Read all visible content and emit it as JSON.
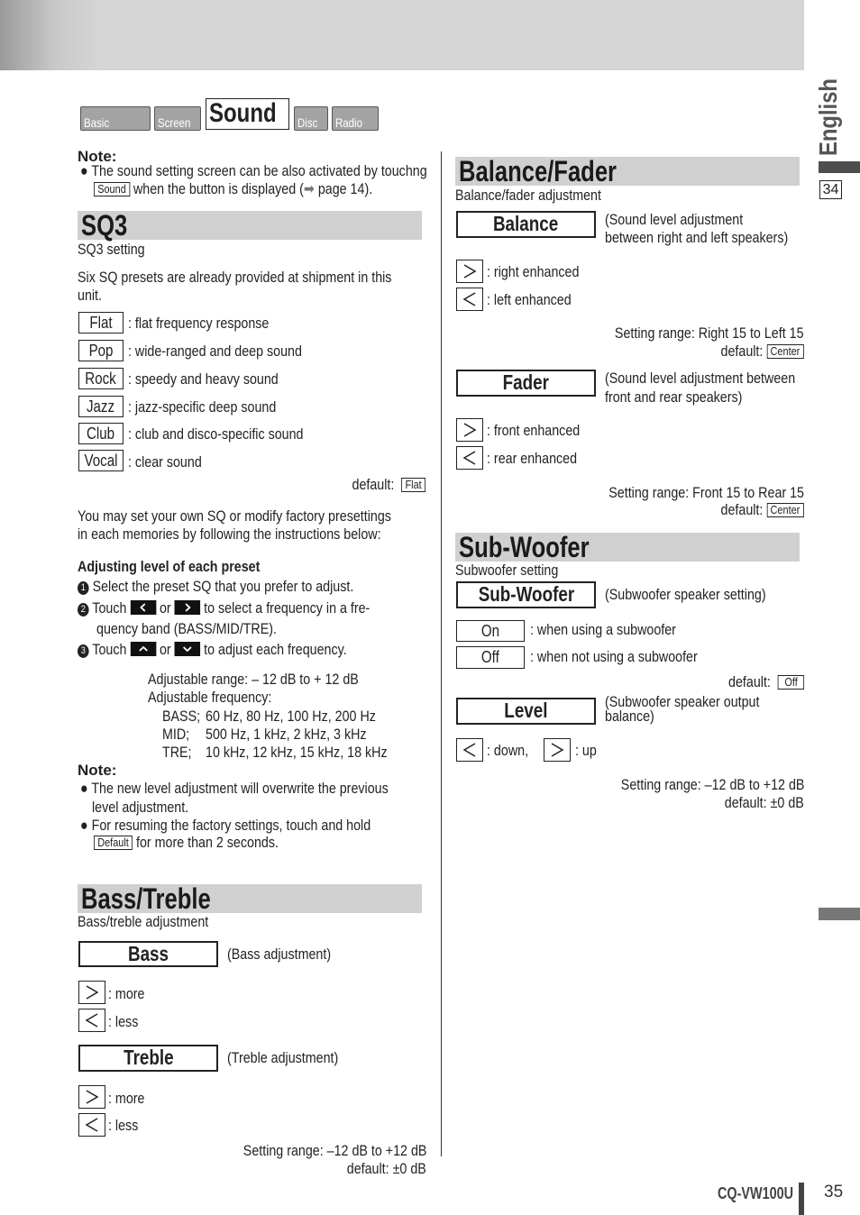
{
  "tabs": [
    "Basic Setting",
    "Screen",
    "Sound",
    "Disc",
    "Radio"
  ],
  "note1": {
    "title": "Note:",
    "line1": "The sound setting screen can be also activated by touchng",
    "button": "Sound",
    "line2": "when the button is displayed (",
    "arrow": "➡",
    "line2b": " page 14)."
  },
  "sq3": {
    "title": "SQ3",
    "subtitle": "SQ3 setting",
    "intro1": "Six SQ presets are already provided at shipment in this",
    "intro2": "unit.",
    "presets": [
      {
        "label": "Flat",
        "desc": ": flat frequency response"
      },
      {
        "label": "Pop",
        "desc": ": wide-ranged and deep sound"
      },
      {
        "label": "Rock",
        "desc": ": speedy and heavy sound"
      },
      {
        "label": "Jazz",
        "desc": ": jazz-specific deep sound"
      },
      {
        "label": "Club",
        "desc": ": club and disco-specific sound"
      },
      {
        "label": "Vocal",
        "desc": ": clear sound"
      }
    ],
    "default_label": "default:",
    "default_value": "Flat",
    "para1": "You may set your own SQ or modify factory presettings",
    "para2": "in each memories by following the instructions below:",
    "adjust_title": "Adjusting level of each preset",
    "step1": "Select the preset SQ that you prefer to adjust.",
    "step2a": "Touch",
    "or": "or",
    "step2b": "to select a frequency in a fre-",
    "step2c": "quency band (BASS/MID/TRE).",
    "step3a": "Touch",
    "step3b": "to adjust each frequency.",
    "range": "Adjustable range: – 12 dB to + 12 dB",
    "freq": "Adjustable frequency:",
    "bands": [
      {
        "name": "BASS;",
        "values": "60 Hz, 80 Hz, 100 Hz, 200 Hz"
      },
      {
        "name": "MID;",
        "values": "500 Hz, 1 kHz, 2 kHz, 3 kHz"
      },
      {
        "name": "TRE;",
        "values": "10 kHz, 12 kHz, 15 kHz, 18 kHz"
      }
    ],
    "note_title": "Note:",
    "note_a1": "The new level adjustment will overwrite the previous",
    "note_a2": "level adjustment.",
    "note_b1": "For resuming the factory settings, touch and hold",
    "note_b_button": "Default",
    "note_b2": "for more than 2 seconds."
  },
  "bass_treble": {
    "title": "Bass/Treble",
    "subtitle": "Bass/treble adjustment",
    "bass": "Bass",
    "bass_desc": "(Bass adjustment)",
    "treble": "Treble",
    "treble_desc": "(Treble adjustment)",
    "more": ": more",
    "less": ": less",
    "range": "Setting range: –12 dB to +12 dB",
    "default": "default: ±0 dB"
  },
  "balance_fader": {
    "title": "Balance/Fader",
    "subtitle": "Balance/fader adjustment",
    "balance": "Balance",
    "balance_desc1": "(Sound level adjustment",
    "balance_desc2": "between right and left speakers)",
    "right": ": right enhanced",
    "left": ": left enhanced",
    "balance_range": "Setting range: Right 15 to Left 15",
    "default_label": "default:",
    "default_value": "Center",
    "fader": "Fader",
    "fader_desc1": "(Sound level adjustment between",
    "fader_desc2": "front and rear speakers)",
    "front": ": front enhanced",
    "rear": ": rear enhanced",
    "fader_range": "Setting range: Front 15 to Rear 15"
  },
  "subwoofer": {
    "title": "Sub-Woofer",
    "subtitle": "Subwoofer setting",
    "button": "Sub-Woofer",
    "desc": "(Subwoofer speaker setting)",
    "on": "On",
    "on_desc": ": when using a subwoofer",
    "off": "Off",
    "off_desc": ": when not using a subwoofer",
    "default_label": "default:",
    "default_value": "Off",
    "level": "Level",
    "level_desc1": "(Subwoofer speaker output",
    "level_desc2": "balance)",
    "down": ": down,",
    "up": ": up",
    "range": "Setting range: –12 dB to +12 dB",
    "default": "default: ±0 dB"
  },
  "sidebar": {
    "language": "English",
    "page_ref": "34"
  },
  "footer": {
    "model": "CQ-VW100U",
    "page": "35"
  }
}
